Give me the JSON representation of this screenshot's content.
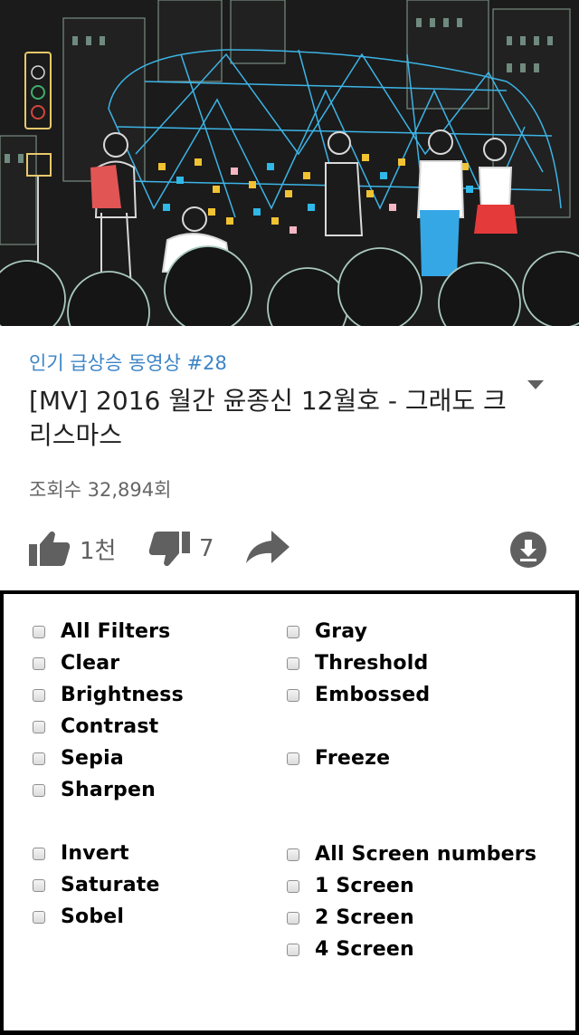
{
  "video": {
    "trending_label": "인기 급상승 동영상 #28",
    "title": "[MV] 2016 월간 윤종신 12월호 - 그래도 크리스마스",
    "views": "조회수 32,894회",
    "likes": "1천",
    "dislikes": "7",
    "icons": [
      "thumbs-up-icon",
      "thumbs-down-icon",
      "share-icon",
      "download-icon",
      "expand-caret-icon"
    ]
  },
  "filters": {
    "left": [
      "All Filters",
      "Clear",
      "Brightness",
      "Contrast",
      "Sepia",
      "Sharpen",
      "Invert",
      "Saturate",
      "Sobel"
    ],
    "right": [
      "Gray",
      "Threshold",
      "Embossed",
      "Freeze",
      "All Screen numbers",
      "1 Screen",
      "2 Screen",
      "4 Screen"
    ]
  },
  "colors": {
    "trending": "#3c84c6",
    "title": "#222222",
    "secondary": "#666666",
    "icon": "#606060",
    "border": "#000000"
  }
}
